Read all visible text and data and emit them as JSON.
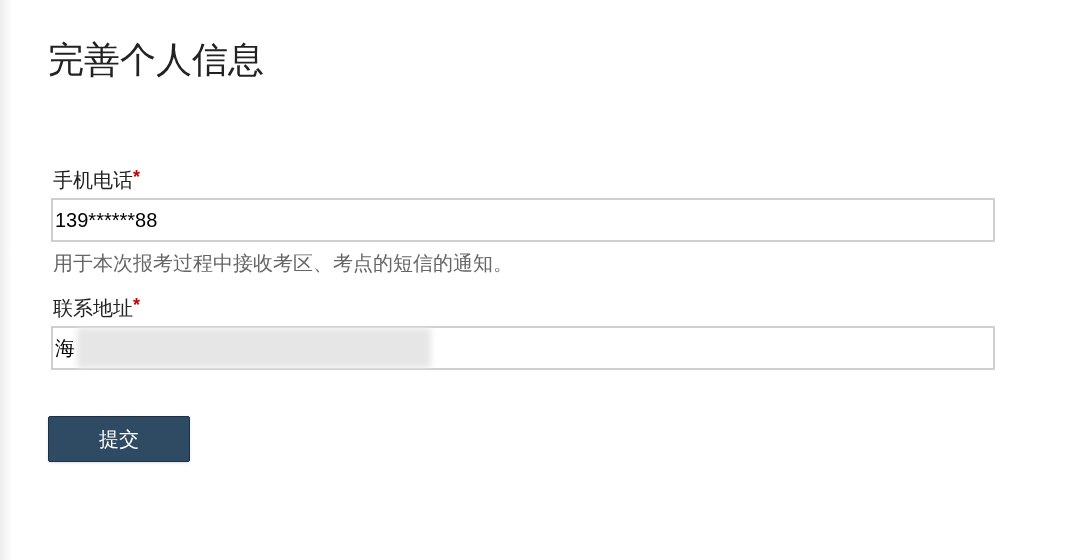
{
  "title": "完善个人信息",
  "fields": [
    {
      "label": "手机电话",
      "required_mark": "*",
      "value": "139******88",
      "hint": "用于本次报考过程中接收考区、考点的短信的通知。"
    },
    {
      "label": "联系地址",
      "required_mark": "*",
      "value": "海",
      "redacted": true
    }
  ],
  "submit_button": "提交"
}
